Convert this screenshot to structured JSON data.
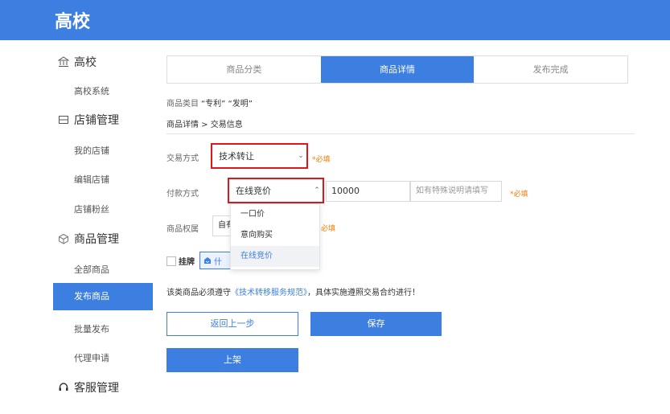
{
  "header": {
    "title": "高校"
  },
  "sidebar": {
    "groups": [
      {
        "label": "高校",
        "icon": "bank-icon"
      },
      {
        "label": "店铺管理",
        "icon": "store-icon"
      },
      {
        "label": "商品管理",
        "icon": "box-icon"
      },
      {
        "label": "客服管理",
        "icon": "headset-icon"
      }
    ],
    "items": {
      "g0_0": "高校系统",
      "g1_0": "我的店铺",
      "g1_1": "编辑店铺",
      "g1_2": "店铺粉丝",
      "g2_0": "全部商品",
      "g2_1": "发布商品",
      "g2_2": "批量发布",
      "g2_3": "代理申请"
    }
  },
  "steps": [
    "商品分类",
    "商品详情",
    "发布完成"
  ],
  "category": {
    "label": "商品类目",
    "values": "“专利” “发明”"
  },
  "breadcrumb": "商品详情 > 交易信息",
  "form": {
    "trade_method": {
      "label": "交易方式",
      "value": "技术转让",
      "required": "*必填"
    },
    "payment_method": {
      "label": "付款方式",
      "value": "在线竞价",
      "amount": "10000",
      "note_placeholder": "如有特殊说明请填写",
      "required": "*必填",
      "options": [
        "一口价",
        "意向购买",
        "在线竞价"
      ]
    },
    "ownership": {
      "label": "商品权属",
      "value": "自有",
      "required": "必填"
    },
    "listing": {
      "label": "挂牌",
      "tag_text": "什"
    }
  },
  "notice": {
    "prefix": "该类商品必须遵守",
    "link": "《技术转移服务规范》",
    "suffix": "，具体实施遵照交易合约进行！"
  },
  "buttons": {
    "back": "返回上一步",
    "save": "保存",
    "publish": "上架"
  },
  "colors": {
    "brand": "#3d7fe0",
    "highlight_border": "#e0161b",
    "required": "#ff7a00"
  }
}
